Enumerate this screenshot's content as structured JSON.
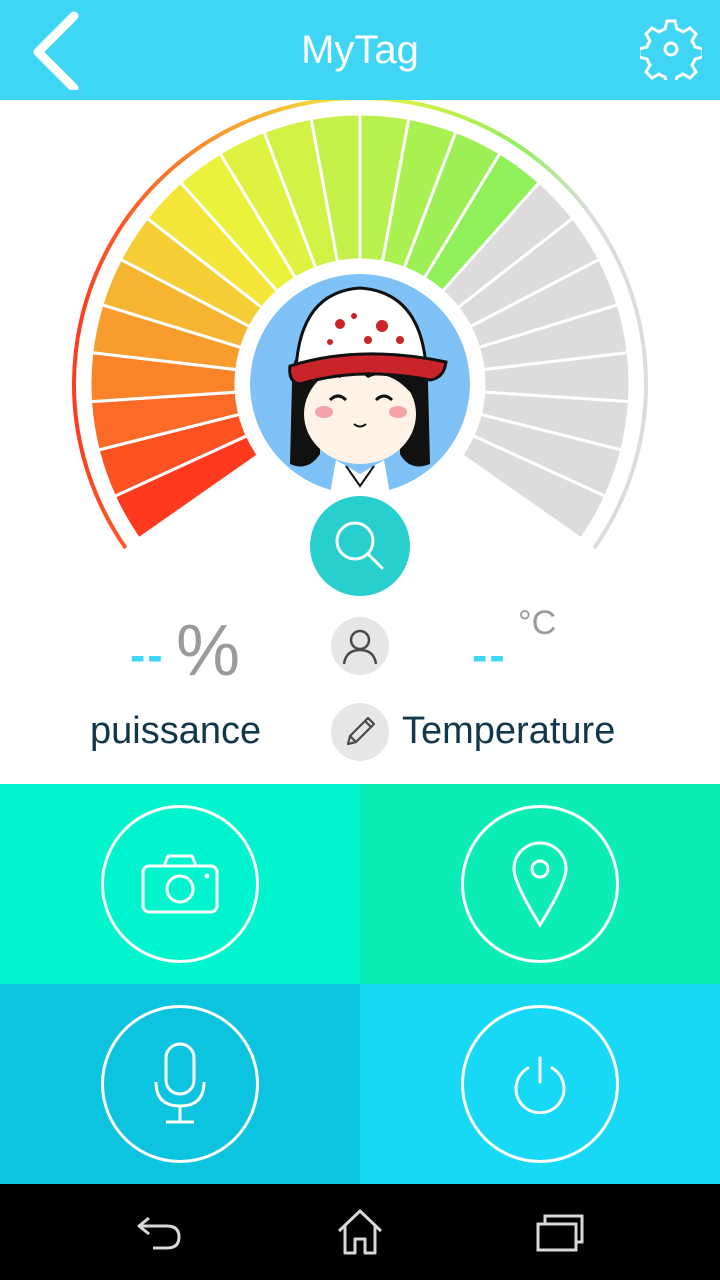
{
  "header": {
    "title": "MyTag",
    "back_icon": "chevron-left-icon",
    "settings_icon": "gear-icon",
    "background": "#3fd6f6"
  },
  "gauge": {
    "colors": {
      "left": "#ff3a1f",
      "mid": "#f2f23a",
      "right": "#8ff05a",
      "inactive": "#dcdcdc"
    }
  },
  "stats": {
    "power": {
      "value": "--",
      "unit": "%",
      "label": "puissance"
    },
    "temperature": {
      "value": "--",
      "unit": "°C",
      "label": "Temperature"
    },
    "value_color": "#3fd6f6"
  },
  "actions": [
    {
      "icon": "camera-icon",
      "color": "#00f5cf"
    },
    {
      "icon": "location-pin-icon",
      "color": "#0cedb6"
    },
    {
      "icon": "microphone-icon",
      "color": "#0cc3e0"
    },
    {
      "icon": "power-icon",
      "color": "#17d9f5"
    }
  ],
  "system_nav": {
    "back_icon": "back-arrow-icon",
    "home_icon": "home-icon",
    "recents_icon": "recent-apps-icon"
  }
}
